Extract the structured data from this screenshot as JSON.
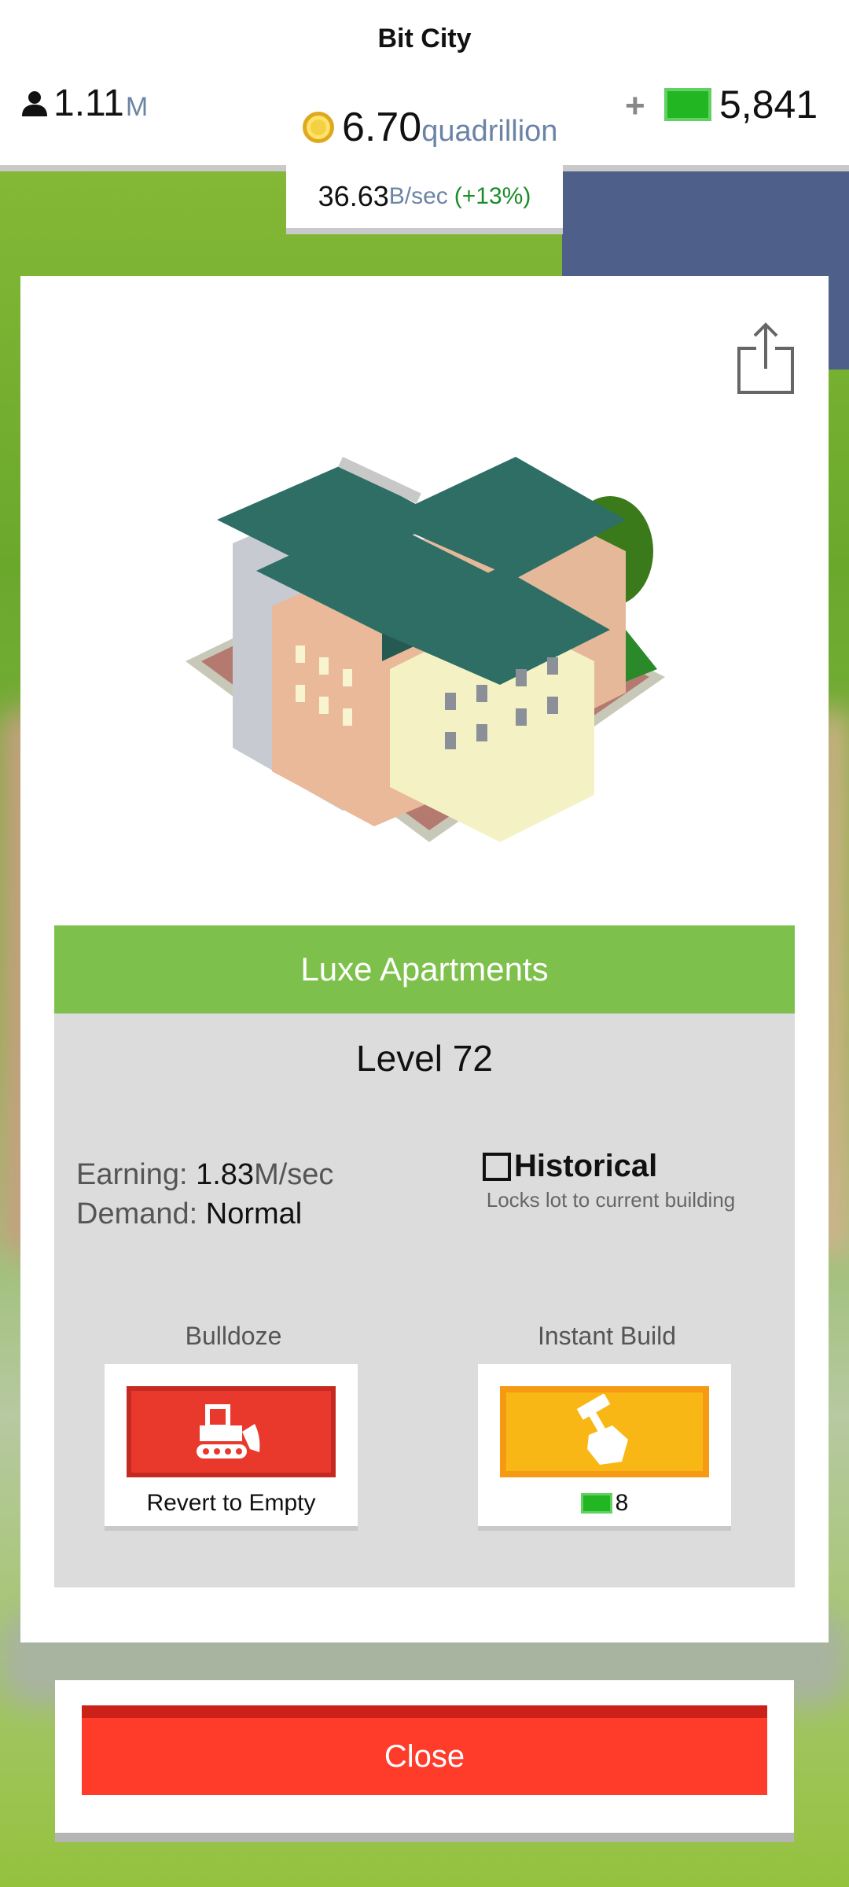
{
  "header": {
    "title": "Bit City",
    "population": {
      "value": "1.11",
      "unit": "M"
    },
    "coins": {
      "value": "6.70",
      "unit": "quadrillion"
    },
    "cash": {
      "plus": "+",
      "value": "5,841"
    },
    "rate": {
      "value": "36.63",
      "unit": "B/sec",
      "bonus": "(+13%)"
    }
  },
  "building": {
    "name": "Luxe Apartments",
    "level": "Level 72",
    "earning_label": "Earning:",
    "earning_value": "1.83",
    "earning_unit": "M/sec",
    "demand_label": "Demand:",
    "demand_value": "Normal",
    "historical_label": "Historical",
    "historical_checked": false,
    "historical_sub": "Locks lot to current building"
  },
  "actions": {
    "bulldoze": {
      "title": "Bulldoze",
      "caption": "Revert to Empty"
    },
    "instant_build": {
      "title": "Instant Build",
      "cost": "8"
    }
  },
  "close_label": "Close",
  "icons": {
    "population": "person-icon",
    "coins": "coin-icon",
    "cash": "cash-icon",
    "share": "share-icon",
    "bulldoze": "bulldozer-icon",
    "instant_build": "hammer-hand-icon"
  },
  "colors": {
    "banner": "#7ec04c",
    "bulldoze": "#e8392c",
    "instant_build": "#f8b714",
    "close": "#ff3b2a",
    "accent_unit": "#6b84a6",
    "bonus_green": "#1a8c2a"
  }
}
